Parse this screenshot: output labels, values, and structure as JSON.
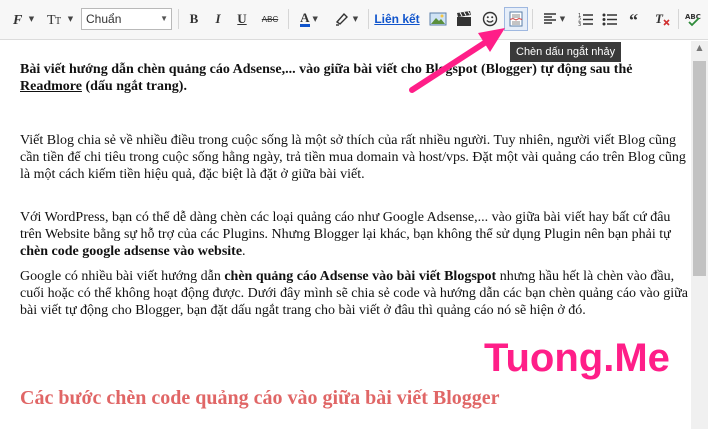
{
  "toolbar": {
    "font_family_icon": "font-family-icon",
    "font_size_icon": "font-size-icon",
    "format_select": {
      "value": "Chuẩn"
    },
    "bold_label": "B",
    "italic_label": "I",
    "underline_label": "U",
    "strike_label": "ABC",
    "text_color_label": "A",
    "link_label": "Liên kết",
    "tooltip": "Chèn dấu ngắt nhảy"
  },
  "colors": {
    "accent_link": "#1155cc",
    "heading": "#e06666",
    "watermark": "#ff1e88",
    "arrow": "#ff1e88"
  },
  "content": {
    "title": {
      "pre": "Bài viết hướng dẫn chèn quảng cáo Adsense,... vào giữa bài viết cho Blogspot (Blogger) tự động sau thẻ ",
      "readmore": "Readmore",
      "post": " (dấu ngắt trang)."
    },
    "paragraph1": "Viết Blog chia sẻ về nhiều điều trong cuộc sống là một sở thích của rất nhiều người. Tuy nhiên, người viết Blog cũng cần tiền để chi tiêu trong cuộc sống hằng ngày, trả tiền mua domain và host/vps. Đặt một vài quảng cáo trên Blog cũng là một cách kiếm tiền hiệu quả, đặc biệt là đặt ở giữa bài viết.",
    "paragraph2": {
      "pre": "Với WordPress, bạn có thể dễ dàng chèn các loại quảng cáo như Google Adsense,... vào giữa bài viết hay bất cứ đâu trên Website bằng sự hỗ trợ của các Plugins. Nhưng Blogger lại khác, bạn không thể sử dụng Plugin nên bạn phải tự ",
      "bold": "chèn code google adsense vào website",
      "post": "."
    },
    "paragraph3": {
      "pre": "Google có nhiều bài viết hướng dẫn ",
      "bold": "chèn quảng cáo Adsense vào bài viết Blogspot",
      "post": " nhưng hầu hết là chèn vào đầu, cuối hoặc có thể không hoạt động được. Dưới đây mình sẽ chia sẻ code và hướng dẫn các bạn chèn quảng cáo vào giữa bài viết tự động cho Blogger, bạn đặt dấu ngắt trang cho bài viết ở đâu thì quảng cáo nó sẽ hiện ở đó."
    },
    "heading": "Các bước chèn code quảng cáo vào giữa bài viết Blogger"
  },
  "watermark": "Tuong.Me"
}
